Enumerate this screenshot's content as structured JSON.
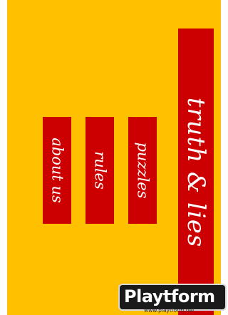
{
  "app": {
    "title": "truth & lies"
  },
  "menu": {
    "about_label": "about us",
    "rules_label": "rules",
    "puzzles_label": "puzzles"
  },
  "watermark": {
    "logo_text": "Playtform",
    "url": "www.playtform.net"
  },
  "colors": {
    "background": "#ffc000",
    "accent": "#cc0000",
    "text": "#ffffff"
  }
}
